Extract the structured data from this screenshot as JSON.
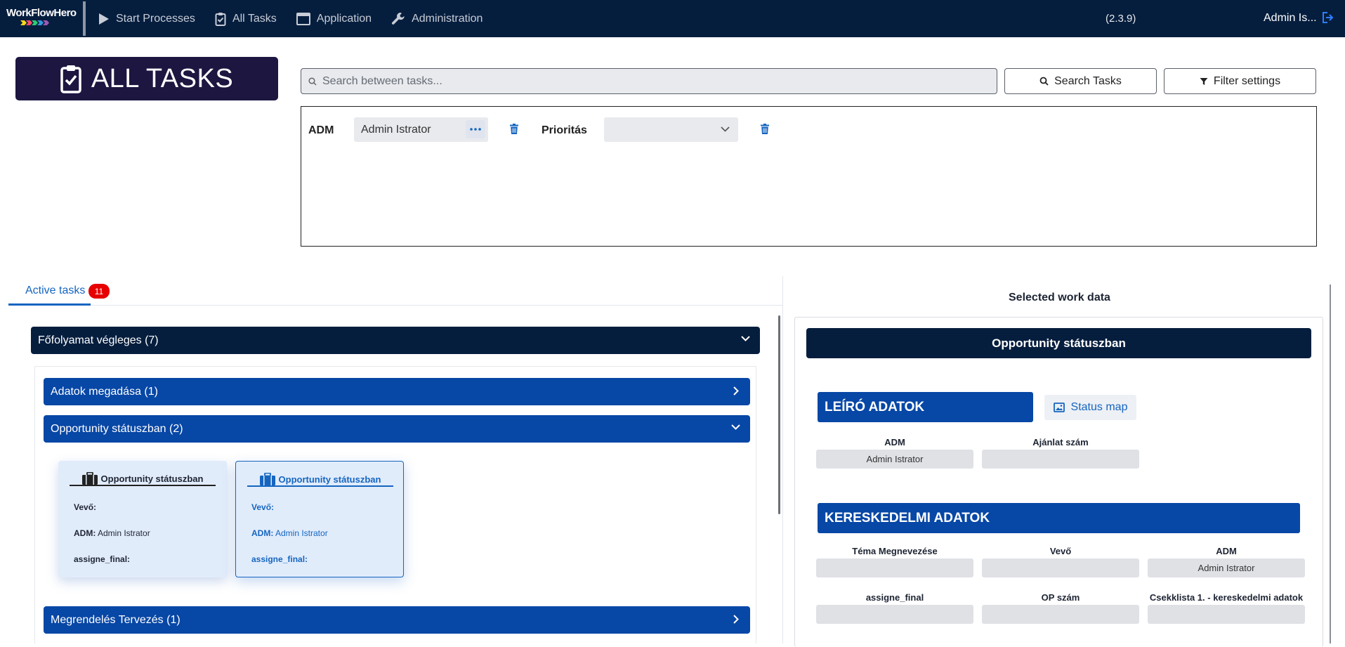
{
  "app": {
    "logo_text": "WorkFlowHero",
    "logo_colors": [
      "#f9d71c",
      "#ff4d6d",
      "#2ecc71",
      "#3498db",
      "#9b59b6"
    ],
    "version": "(2.3.9)",
    "user": "Admin Is...",
    "nav": [
      {
        "label": "Start Processes",
        "icon": "play-icon"
      },
      {
        "label": "All Tasks",
        "icon": "clipboard-check-icon"
      },
      {
        "label": "Application",
        "icon": "window-icon"
      },
      {
        "label": "Administration",
        "icon": "wrench-icon"
      }
    ]
  },
  "page": {
    "title": "ALL TASKS"
  },
  "search": {
    "placeholder": "Search between tasks...",
    "search_button": "Search Tasks",
    "filter_button": "Filter settings"
  },
  "filters": {
    "adm_label": "ADM",
    "adm_value": "Admin Istrator",
    "priority_label": "Prioritás",
    "priority_value": ""
  },
  "tasks": {
    "tab_label": "Active tasks",
    "count": "11",
    "group": "Főfolyamat végleges (7)",
    "subgroups": [
      "Adatok megadása (1)",
      "Opportunity státuszban (2)",
      "Megrendelés Tervezés (1)"
    ],
    "cards": [
      {
        "title": "Opportunity státuszban",
        "vevo_label": "Vevő:",
        "vevo": "",
        "adm_label": "ADM:",
        "adm": "Admin Istrator",
        "assigne_label": "assigne_final:",
        "assigne": ""
      },
      {
        "title": "Opportunity státuszban",
        "vevo_label": "Vevő:",
        "vevo": "",
        "adm_label": "ADM:",
        "adm": "Admin Istrator",
        "assigne_label": "assigne_final:",
        "assigne": ""
      }
    ]
  },
  "detail": {
    "panel_title": "Selected work data",
    "header": "Opportunity státuszban",
    "section1": "LEÍRÓ ADATOK",
    "status_map": "Status map",
    "section1_fields": [
      {
        "label": "ADM",
        "value": "Admin Istrator"
      },
      {
        "label": "Ajánlat szám",
        "value": ""
      }
    ],
    "section2": "KERESKEDELMI ADATOK",
    "section2_fields": [
      {
        "label": "Téma Megnevezése",
        "value": ""
      },
      {
        "label": "Vevő",
        "value": ""
      },
      {
        "label": "ADM",
        "value": "Admin Istrator"
      },
      {
        "label": "assigne_final",
        "value": ""
      },
      {
        "label": "OP szám",
        "value": ""
      },
      {
        "label": "Csekklista 1. - kereskedelmi adatok",
        "value": ""
      }
    ]
  }
}
